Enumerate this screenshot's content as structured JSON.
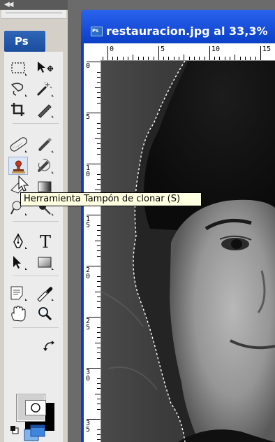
{
  "toolbar": {
    "collapse_glyph": "◀◀",
    "app_logo": "Ps",
    "active_tool": "clone-stamp-tool",
    "icons": [
      "rectangular-marquee-icon",
      "move-icon",
      "lasso-icon",
      "magic-wand-icon",
      "crop-icon",
      "eyedropper-slice-icon",
      "spot-healing-brush-icon",
      "brush-icon",
      "clone-stamp-icon",
      "history-brush-icon",
      "eraser-icon",
      "gradient-icon",
      "dodge-icon",
      "sharpen-icon",
      "pen-icon",
      "type-icon",
      "path-selection-icon",
      "rectangle-shape-icon",
      "notes-icon",
      "eyedropper-icon",
      "hand-icon",
      "zoom-icon",
      "swap-colors-icon",
      "default-colors-icon",
      "quick-mask-icon",
      "screen-mode-icon"
    ],
    "type_glyph": "T",
    "foreground_color": "#d0d0d0",
    "background_color": "#000000"
  },
  "document": {
    "title": "restauracion.jpg al 33,3%",
    "icon_label": "Ps",
    "ruler_top": [
      "0",
      "5",
      "10",
      "15"
    ],
    "ruler_left": [
      "0",
      "5",
      "10",
      "15",
      "20",
      "25",
      "30",
      "35"
    ]
  },
  "tooltip": {
    "text": "Herramienta Tampón de clonar (S)"
  }
}
